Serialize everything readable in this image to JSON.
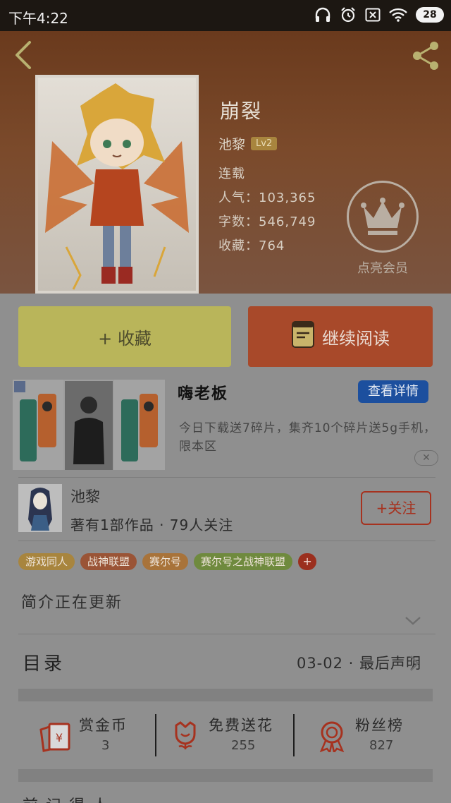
{
  "status_bar": {
    "time": "下午4:22",
    "battery": "28"
  },
  "book": {
    "title": "崩裂",
    "author": "池黎",
    "level": "Lv2",
    "status": "连载",
    "popularity": "人气：103,365",
    "word_count": "字数：546,749",
    "favorites": "收藏：764"
  },
  "vip": {
    "label": "点亮会员"
  },
  "actions": {
    "collect_label": "+ 收藏",
    "read_label": "继续阅读"
  },
  "ad": {
    "title": "嗨老板",
    "detail_button": "查看详情",
    "description": "今日下载送7碎片，集齐10个碎片送5g手机，限本区",
    "close": "✕"
  },
  "author_card": {
    "name": "池黎",
    "stats": "著有1部作品 · 79人关注",
    "follow_label": "+关注"
  },
  "tags": [
    {
      "label": "游戏同人",
      "color": "#a8853e"
    },
    {
      "label": "战神联盟",
      "color": "#9a5436"
    },
    {
      "label": "赛尔号",
      "color": "#a8733a"
    },
    {
      "label": "赛尔号之战神联盟",
      "color": "#6f8a3e"
    }
  ],
  "tag_add": "+",
  "intro": "简介正在更新",
  "toc": {
    "label": "目录",
    "latest": "03-02 · 最后声明"
  },
  "stats": [
    {
      "label": "赏金币",
      "value": "3",
      "icon": "red-envelope-icon"
    },
    {
      "label": "免费送花",
      "value": "255",
      "icon": "flower-icon"
    },
    {
      "label": "粉丝榜",
      "value": "827",
      "icon": "medal-icon"
    }
  ],
  "footer_partial": "前 记 得 人"
}
